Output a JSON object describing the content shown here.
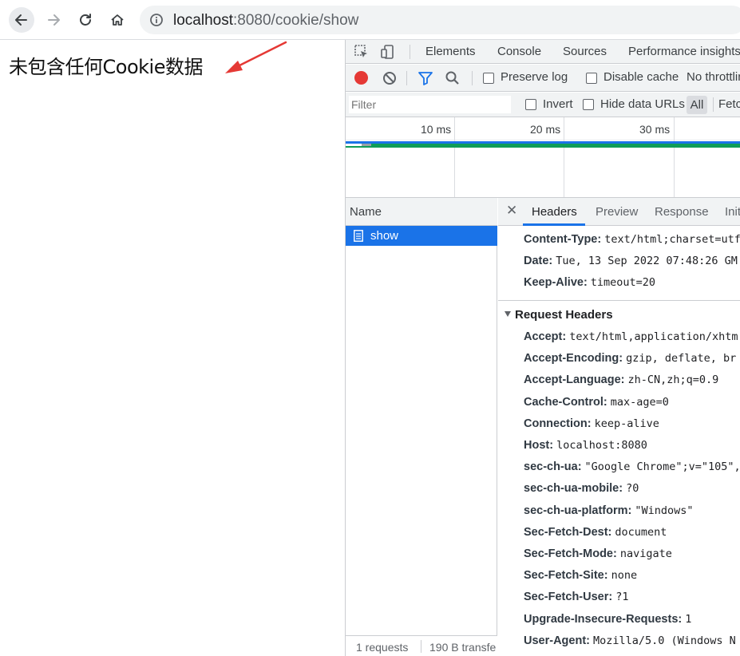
{
  "browser": {
    "url_host": "localhost",
    "url_rest": ":8080/cookie/show"
  },
  "page": {
    "message": "未包含任何Cookie数据",
    "arrow_color": "#e53935"
  },
  "devtools": {
    "tabs": [
      "Elements",
      "Console",
      "Sources",
      "Performance insights"
    ],
    "network_toolbar": {
      "preserve_log": "Preserve log",
      "disable_cache": "Disable cache",
      "throttling": "No throttlin"
    },
    "filter": {
      "placeholder": "Filter",
      "invert": "Invert",
      "hide_data_urls": "Hide data URLs",
      "all": "All",
      "fetch": "Fetc"
    },
    "timeline": {
      "ticks": [
        "10 ms",
        "20 ms",
        "30 ms"
      ]
    },
    "name_pane": {
      "header": "Name",
      "request_name": "show",
      "status_requests": "1 requests",
      "status_transferred": "190 B transfe"
    },
    "details": {
      "tabs": [
        "Headers",
        "Preview",
        "Response",
        "Initi"
      ],
      "response_headers": [
        {
          "key": "Content-Type:",
          "value": "text/html;charset=utf"
        },
        {
          "key": "Date:",
          "value": "Tue, 13 Sep 2022 07:48:26 GM"
        },
        {
          "key": "Keep-Alive:",
          "value": "timeout=20"
        }
      ],
      "request_headers_title": "Request Headers",
      "request_headers": [
        {
          "key": "Accept:",
          "value": "text/html,application/xhtm"
        },
        {
          "key": "Accept-Encoding:",
          "value": "gzip, deflate, br"
        },
        {
          "key": "Accept-Language:",
          "value": "zh-CN,zh;q=0.9"
        },
        {
          "key": "Cache-Control:",
          "value": "max-age=0"
        },
        {
          "key": "Connection:",
          "value": "keep-alive"
        },
        {
          "key": "Host:",
          "value": "localhost:8080"
        },
        {
          "key": "sec-ch-ua:",
          "value": "\"Google Chrome\";v=\"105\","
        },
        {
          "key": "sec-ch-ua-mobile:",
          "value": "?0"
        },
        {
          "key": "sec-ch-ua-platform:",
          "value": "\"Windows\""
        },
        {
          "key": "Sec-Fetch-Dest:",
          "value": "document"
        },
        {
          "key": "Sec-Fetch-Mode:",
          "value": "navigate"
        },
        {
          "key": "Sec-Fetch-Site:",
          "value": "none"
        },
        {
          "key": "Sec-Fetch-User:",
          "value": "?1"
        },
        {
          "key": "Upgrade-Insecure-Requests:",
          "value": "1"
        },
        {
          "key": "User-Agent:",
          "value": "Mozilla/5.0 (Windows N"
        }
      ]
    }
  }
}
